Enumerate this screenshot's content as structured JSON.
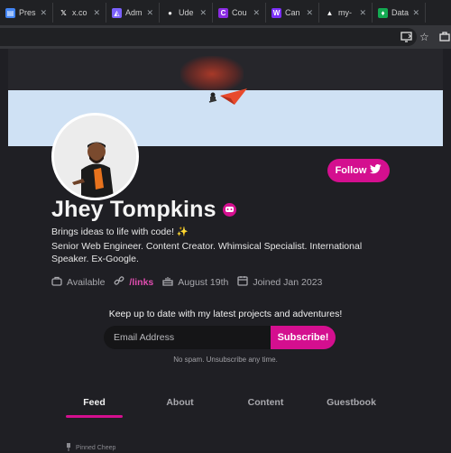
{
  "browser": {
    "tabs": [
      {
        "title": "Pres",
        "icon": "presentation-icon",
        "color": "#4285f4",
        "glyph": "▤"
      },
      {
        "title": "x.co",
        "icon": "x-logo-icon",
        "color": "#111111",
        "glyph": "𝕏"
      },
      {
        "title": "Adm",
        "icon": "admin-icon",
        "color": "#7b61ff",
        "glyph": "◭"
      },
      {
        "title": "Ude",
        "icon": "github-icon",
        "color": "#e8e8e8",
        "glyph": "●"
      },
      {
        "title": "Cou",
        "icon": "course-icon",
        "color": "#8a2be2",
        "glyph": "C"
      },
      {
        "title": "Can",
        "icon": "canva-icon",
        "color": "#7b2ff7",
        "glyph": "W"
      },
      {
        "title": "my-",
        "icon": "vercel-icon",
        "color": "#ffffff",
        "glyph": "▲"
      },
      {
        "title": "Data",
        "icon": "mongodb-leaf-icon",
        "color": "#13aa52",
        "glyph": "♦"
      }
    ]
  },
  "profile": {
    "name": "Jhey Tompkins",
    "tagline": "Brings ideas to life with code! ✨",
    "bio": "Senior Web Engineer. Content Creator. Whimsical Specialist. International Speaker. Ex-Google.",
    "follow_label": "Follow",
    "meta": {
      "availability": "Available",
      "links_label": "/links",
      "birthday": "August 19th",
      "joined": "Joined Jan 2023"
    }
  },
  "newsletter": {
    "title": "Keep up to date with my latest projects and adventures!",
    "placeholder": "Email Address",
    "button": "Subscribe!",
    "note": "No spam. Unsubscribe any time."
  },
  "profile_tabs": [
    {
      "label": "Feed",
      "active": true
    },
    {
      "label": "About",
      "active": false
    },
    {
      "label": "Content",
      "active": false
    },
    {
      "label": "Guestbook",
      "active": false
    }
  ],
  "feed": {
    "pinned_label": "Pinned Cheep"
  },
  "colors": {
    "accent": "#d40f8f",
    "background": "#1f1f24",
    "banner": "#cfe1f4"
  }
}
